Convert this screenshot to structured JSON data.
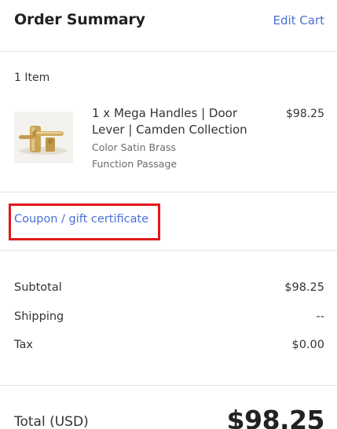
{
  "header": {
    "title": "Order Summary",
    "edit_cart_label": "Edit Cart"
  },
  "cart": {
    "item_count": "1 Item",
    "items": [
      {
        "name": "1 x Mega Handles | Door Lever | Camden Collection",
        "price": "$98.25",
        "options": [
          "Color Satin Brass",
          "Function Passage"
        ],
        "thumbnail_icon": "door-lever-image"
      }
    ]
  },
  "coupon": {
    "label": "Coupon / gift certificate"
  },
  "totals": {
    "subtotal_label": "Subtotal",
    "subtotal_value": "$98.25",
    "shipping_label": "Shipping",
    "shipping_value": "--",
    "tax_label": "Tax",
    "tax_value": "$0.00",
    "total_label": "Total (USD)",
    "total_value": "$98.25"
  },
  "colors": {
    "link": "#4a6fd6",
    "highlight_border": "#e0191b"
  }
}
